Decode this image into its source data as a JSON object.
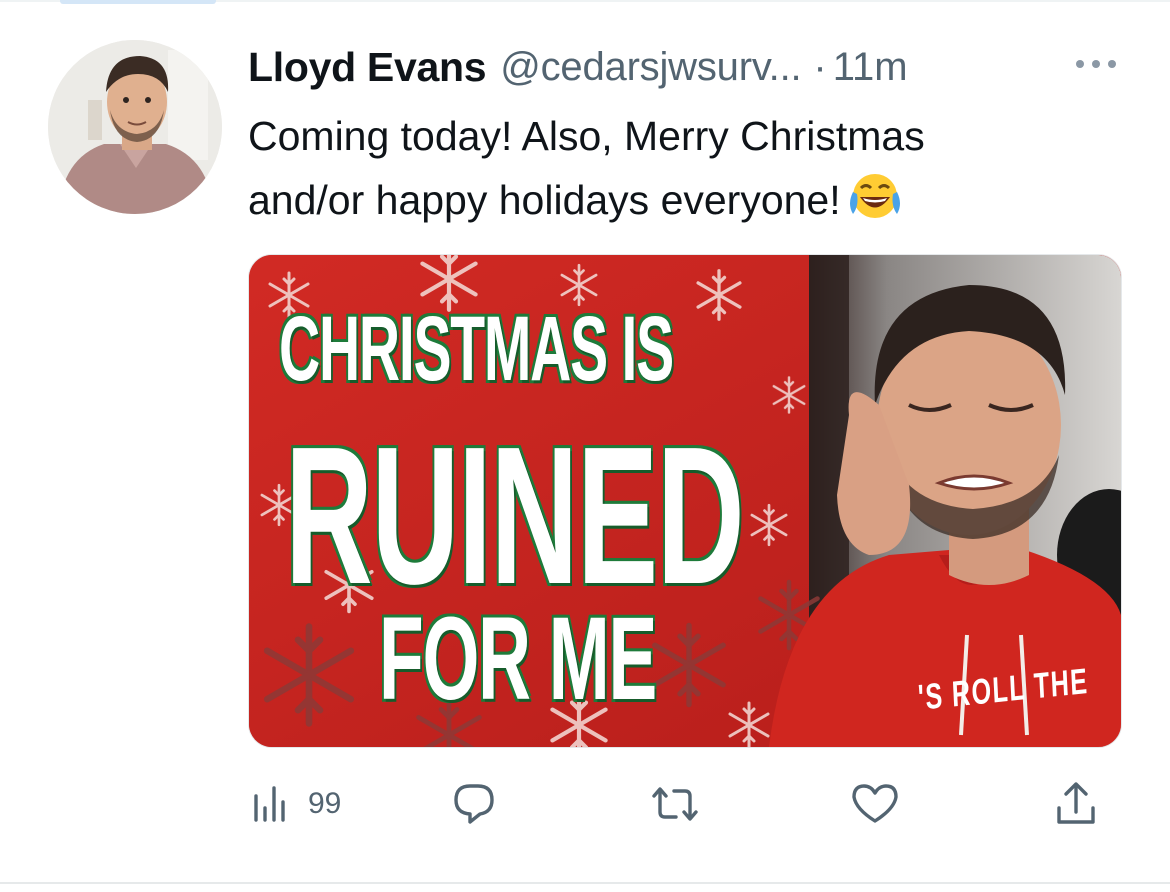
{
  "tweet": {
    "author": {
      "display_name": "Lloyd Evans",
      "handle": "@cedarsjwsurv...",
      "avatar": "avatar-photo"
    },
    "separator": "·",
    "timestamp": "11m",
    "more_icon": "more-horizontal-icon",
    "text_lines": [
      "Coming today! Also, Merry Christmas",
      "and/or happy holidays everyone!"
    ],
    "emoji": "face-with-tears-of-joy-emoji",
    "media": {
      "thumbnail": "youtube-thumbnail",
      "title_lines": [
        "CHRISTMAS IS",
        "RUINED",
        "FOR ME"
      ],
      "hoodie_text": "'S ROLL THE"
    },
    "actions": {
      "views": {
        "icon": "views-chart-icon",
        "count": "99"
      },
      "reply": {
        "icon": "reply-bubble-icon"
      },
      "retweet": {
        "icon": "retweet-icon"
      },
      "like": {
        "icon": "heart-icon"
      },
      "share": {
        "icon": "share-upload-icon"
      }
    }
  },
  "colors": {
    "text_primary": "#0f1419",
    "text_secondary": "#536471",
    "thumbnail_red": "#c8231f",
    "title_stroke_green": "#1e7b3a"
  }
}
